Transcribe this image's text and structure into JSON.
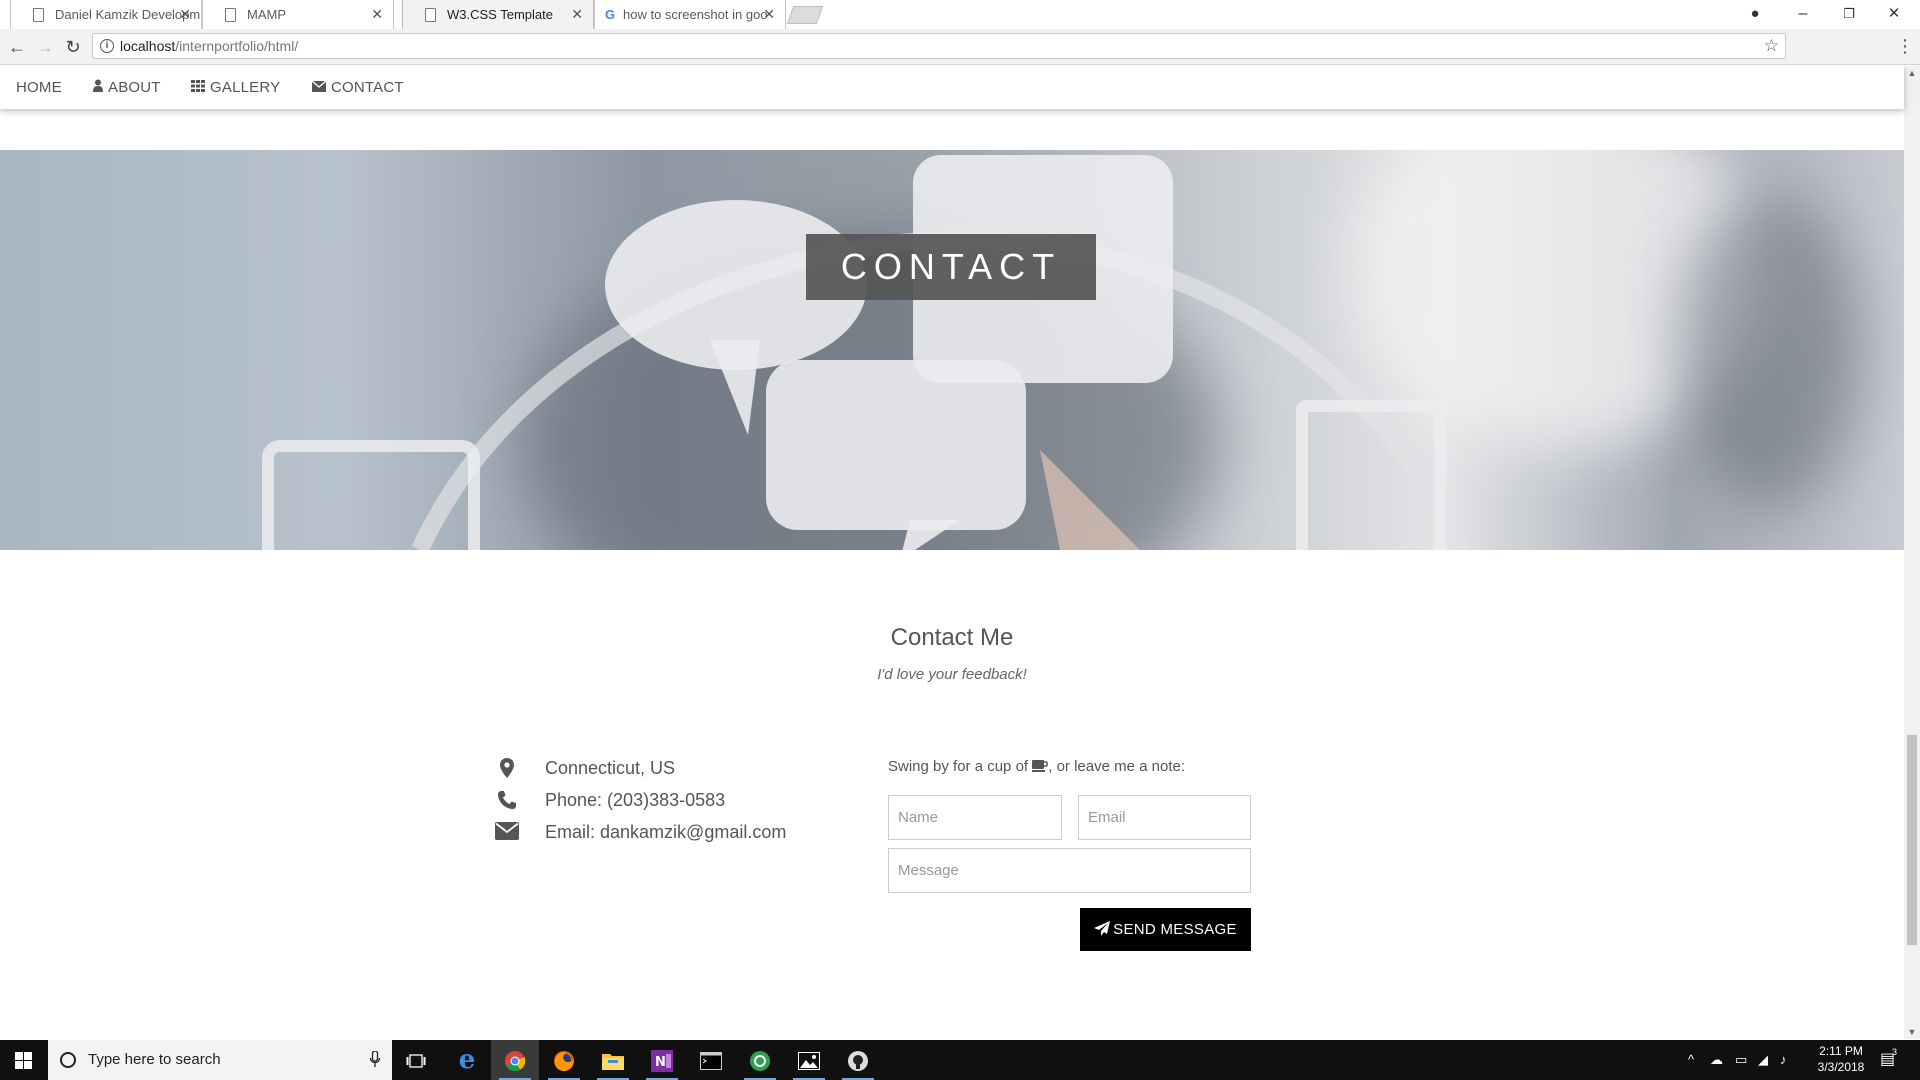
{
  "browser": {
    "tabs": [
      {
        "title": "Daniel Kamzik Developm",
        "icon": "page-icon",
        "active": false
      },
      {
        "title": "MAMP",
        "icon": "page-icon",
        "active": false
      },
      {
        "title": "W3.CSS Template",
        "icon": "page-icon",
        "active": true
      },
      {
        "title": "how to screenshot in goo",
        "icon": "google-icon",
        "active": false
      }
    ],
    "url_host": "localhost",
    "url_path": "/internportfolio/html/"
  },
  "site_nav": {
    "home": "HOME",
    "about": "ABOUT",
    "gallery": "GALLERY",
    "contact": "CONTACT"
  },
  "hero": {
    "title": "CONTACT"
  },
  "contact": {
    "heading": "Contact Me",
    "subheading": "I'd love your feedback!",
    "location": "Connecticut, US",
    "phone": "Phone: (203)383-0583",
    "email": "Email: dankamzik@gmail.com",
    "form_intro_before": "Swing by for a cup of ",
    "form_intro_after": ", or leave me a note:",
    "name_placeholder": "Name",
    "email_placeholder": "Email",
    "message_placeholder": "Message",
    "send_label": "SEND MESSAGE"
  },
  "taskbar": {
    "search_placeholder": "Type here to search",
    "time": "2:11 PM",
    "date": "3/3/2018",
    "notification_count": "3",
    "apps": [
      "task-view-icon",
      "edge-icon",
      "chrome-icon",
      "firefox-icon",
      "file-explorer-icon",
      "onenote-icon",
      "terminal-icon",
      "app-icon",
      "photos-icon",
      "github-icon"
    ]
  }
}
